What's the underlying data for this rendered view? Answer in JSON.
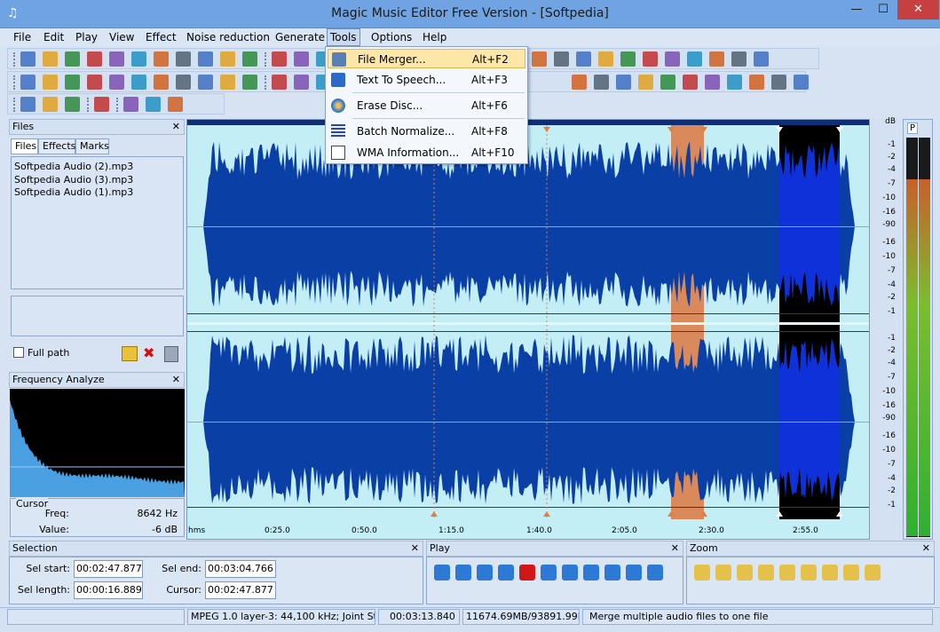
{
  "window": {
    "title": "Magic Music Editor Free Version - [Softpedia]",
    "min": "—",
    "max": "☐",
    "close": "✕"
  },
  "menu": [
    "File",
    "Edit",
    "Play",
    "View",
    "Effect",
    "Noise reduction",
    "Generate",
    "Tools",
    "Options",
    "Help"
  ],
  "tools_menu": [
    {
      "label": "File Merger...",
      "shortcut": "Alt+F2",
      "icon": "file-merger-icon"
    },
    {
      "label": "Text To Speech...",
      "shortcut": "Alt+F3",
      "icon": "text-to-speech-icon"
    },
    {
      "label": "Erase Disc...",
      "shortcut": "Alt+F6",
      "icon": "erase-disc-icon"
    },
    {
      "label": "Batch Normalize...",
      "shortcut": "Alt+F8",
      "icon": "batch-normalize-icon"
    },
    {
      "label": "WMA Information...",
      "shortcut": "Alt+F10",
      "icon": "wma-info-icon"
    }
  ],
  "files_panel": {
    "title": "Files",
    "tabs": [
      "Files",
      "Effects",
      "Marks"
    ],
    "items": [
      "Softpedia Audio (2).mp3",
      "Softpedia Audio (3).mp3",
      "Softpedia Audio (1).mp3"
    ],
    "full_path": "Full path"
  },
  "freq_panel": {
    "title": "Frequency Analyze",
    "cursor_legend": "Cursor",
    "freq_label": "Freq:",
    "freq_value": "8642 Hz",
    "value_label": "Value:",
    "value_value": "-6 dB"
  },
  "waveform": {
    "db_header": "dB",
    "db_ticks": [
      "-1",
      "-2",
      "-4",
      "-7",
      "-10",
      "-16",
      "-90",
      "-16",
      "-10",
      "-7",
      "-4",
      "-2",
      "-1"
    ],
    "time_labels": [
      "hms",
      "0:25.0",
      "0:50.0",
      "1:15.0",
      "1:40.0",
      "2:05.0",
      "2:30.0",
      "2:55.0"
    ],
    "colors": {
      "bg": "#c3eef6",
      "wave": "#0a3fa6",
      "marked": "#d9895a",
      "selected_bg": "#000000",
      "selected_wave": "#1030e0"
    }
  },
  "meter": {
    "label": "P",
    "left_level": 0.9,
    "right_level": 0.9
  },
  "selection_panel": {
    "title": "Selection",
    "sel_start_label": "Sel start:",
    "sel_start": "00:02:47.877",
    "sel_end_label": "Sel end:",
    "sel_end": "00:03:04.766",
    "sel_length_label": "Sel length:",
    "sel_length": "00:00:16.889",
    "cursor_label": "Cursor:",
    "cursor": "00:02:47.877"
  },
  "play_panel": {
    "title": "Play"
  },
  "zoom_panel": {
    "title": "Zoom"
  },
  "status": {
    "format": "MPEG 1.0 layer-3: 44,100 kHz; Joint Stereo",
    "duration": "00:03:13.840",
    "memory": "11674.69MB/93891.99MB",
    "hint": "Merge multiple audio files to one file"
  }
}
